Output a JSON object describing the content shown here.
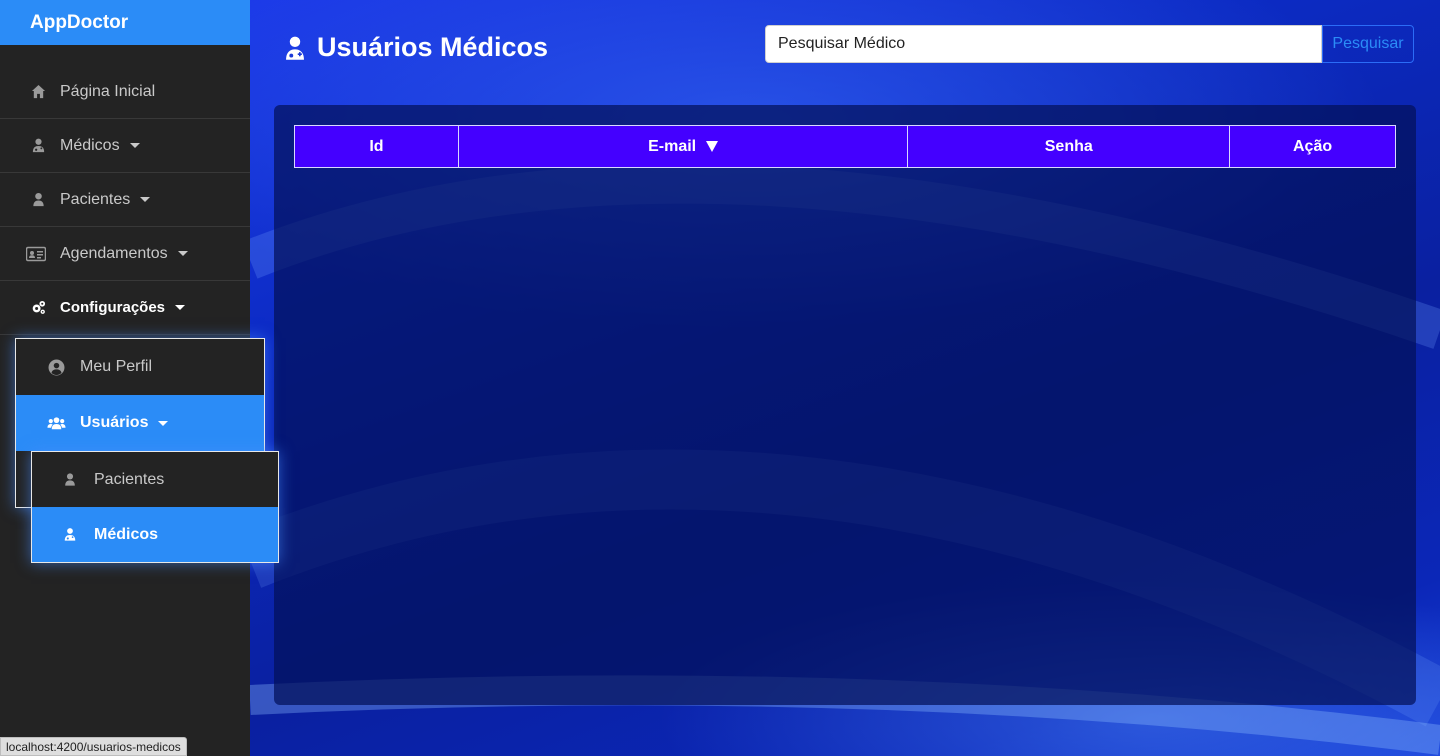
{
  "app": {
    "brand": "AppDoctor"
  },
  "sidebar": {
    "items": [
      {
        "label": "Página Inicial",
        "icon": "home-icon"
      },
      {
        "label": "Médicos",
        "icon": "doctor-icon"
      },
      {
        "label": "Pacientes",
        "icon": "user-icon"
      },
      {
        "label": "Agendamentos",
        "icon": "id-card-icon"
      },
      {
        "label": "Configurações",
        "icon": "gears-icon"
      }
    ]
  },
  "config_menu": {
    "items": [
      {
        "label": "Meu Perfil",
        "icon": "user-circle-icon"
      },
      {
        "label": "Usuários",
        "icon": "users-icon"
      }
    ]
  },
  "users_menu": {
    "items": [
      {
        "label": "Pacientes",
        "icon": "user-icon"
      },
      {
        "label": "Médicos",
        "icon": "doctor-icon"
      }
    ]
  },
  "page": {
    "title": "Usuários Médicos"
  },
  "search": {
    "value": "Pesquisar Médico",
    "button_label": "Pesquisar"
  },
  "table": {
    "headers": [
      "Id",
      "E-mail",
      "Senha",
      "Ação"
    ],
    "rows": []
  },
  "status_bar": {
    "url": "localhost:4200/usuarios-medicos"
  },
  "colors": {
    "brand": "#2b8cf7",
    "sidebar": "#232323",
    "table_header": "#4400ff"
  }
}
